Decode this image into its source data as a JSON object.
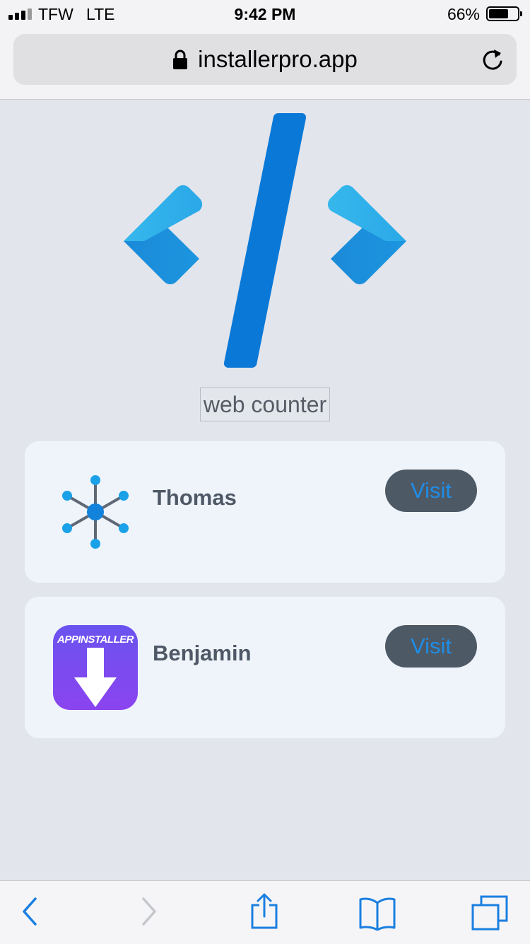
{
  "status_bar": {
    "carrier": "TFW",
    "network": "LTE",
    "time": "9:42 PM",
    "battery_percent": "66%",
    "battery_level": 0.66
  },
  "browser": {
    "url": "installerpro.app",
    "icons": [
      "lock-icon",
      "reload-icon"
    ]
  },
  "page": {
    "logo_icon": "code-brackets-logo",
    "counter_label": "web counter",
    "apps": [
      {
        "name": "Thomas",
        "button_label": "Visit",
        "icon": "network-hub-icon"
      },
      {
        "name": "Benjamin",
        "button_label": "Visit",
        "icon": "appinstaller-icon",
        "icon_text": "APPINSTALLER"
      }
    ]
  },
  "toolbar": {
    "items": [
      "back-icon",
      "forward-icon",
      "share-icon",
      "bookmarks-icon",
      "tabs-icon"
    ]
  },
  "colors": {
    "accent": "#1a7fe0",
    "visit_button": "#4e5966",
    "card": "#eff4fb",
    "background": "#e2e5ec"
  }
}
